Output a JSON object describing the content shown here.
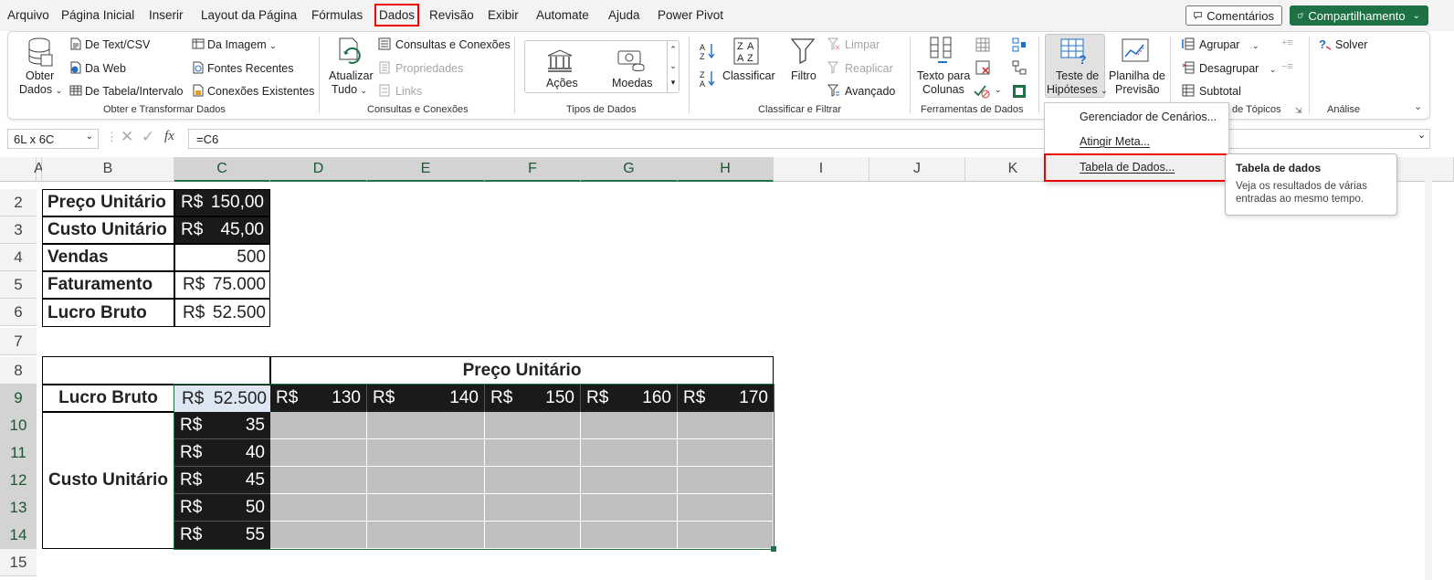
{
  "tabs": [
    "Arquivo",
    "Página Inicial",
    "Inserir",
    "Layout da Página",
    "Fórmulas",
    "Dados",
    "Revisão",
    "Exibir",
    "Automate",
    "Ajuda",
    "Power Pivot"
  ],
  "active_tab": "Dados",
  "header": {
    "comments": "Comentários",
    "share": "Compartilhamento"
  },
  "ribbon": {
    "get_data": {
      "label1": "Obter",
      "label2": "Dados"
    },
    "from_text_csv": "De Text/CSV",
    "from_web": "Da Web",
    "from_table": "De Tabela/Intervalo",
    "from_image": "Da Imagem",
    "recent_sources": "Fontes Recentes",
    "existing_connections": "Conexões Existentes",
    "group_get_transform": "Obter e Transformar Dados",
    "refresh_all": {
      "label1": "Atualizar",
      "label2": "Tudo"
    },
    "queries_connections": "Consultas e Conexões",
    "properties": "Propriedades",
    "links": "Links",
    "group_queries": "Consultas e Conexões",
    "stocks": "Ações",
    "currencies": "Moedas",
    "group_data_types": "Tipos de Dados",
    "sort": "Classificar",
    "filter": "Filtro",
    "clear": "Limpar",
    "reapply": "Reaplicar",
    "advanced": "Avançado",
    "group_sort_filter": "Classificar e Filtrar",
    "text_to_columns": {
      "label1": "Texto para",
      "label2": "Colunas"
    },
    "group_data_tools": "Ferramentas de Dados",
    "what_if": {
      "label1": "Teste de",
      "label2": "Hipóteses"
    },
    "forecast_sheet": {
      "label1": "Planilha de",
      "label2": "Previsão"
    },
    "group": "Agrupar",
    "ungroup": "Desagrupar",
    "subtotal": "Subtotal",
    "group_outline": "de Tópicos",
    "solver": "Solver",
    "group_analysis": "Análise"
  },
  "formula_bar": {
    "name_box": "6L x 6C",
    "formula": "=C6",
    "fx": "fx"
  },
  "columns": [
    "A",
    "B",
    "C",
    "D",
    "E",
    "F",
    "G",
    "H",
    "I",
    "J",
    "K"
  ],
  "rows": [
    "2",
    "3",
    "4",
    "5",
    "6",
    "7",
    "8",
    "9",
    "10",
    "11",
    "12",
    "13",
    "14",
    "15"
  ],
  "sheet": {
    "labels": [
      "Preço Unitário",
      "Custo Unitário",
      "Vendas",
      "Faturamento",
      "Lucro Bruto"
    ],
    "values": [
      {
        "cur": "R$",
        "num": "150,00"
      },
      {
        "cur": "R$",
        "num": "45,00"
      },
      {
        "cur": "",
        "num": "500"
      },
      {
        "cur": "R$",
        "num": "75.000"
      },
      {
        "cur": "R$",
        "num": "52.500"
      }
    ],
    "data_table": {
      "header": "Preço Unitário",
      "corner_label": "Lucro Bruto",
      "corner_value": {
        "cur": "R$",
        "num": "52.500"
      },
      "row_label": "Custo Unitário",
      "prices": [
        "130",
        "140",
        "150",
        "160",
        "170"
      ],
      "costs": [
        "35",
        "40",
        "45",
        "50",
        "55"
      ],
      "currency": "R$"
    }
  },
  "menu": {
    "items": [
      "Gerenciador de Cenários...",
      "Atingir Meta...",
      "Tabela de Dados..."
    ]
  },
  "tooltip": {
    "title": "Tabela de dados",
    "text1": "Veja os resultados de várias",
    "text2": "entradas ao mesmo tempo."
  },
  "colors": {
    "excel_green": "#1e7145",
    "highlight_red": "#e00000",
    "dark_cell": "#1a1a1a",
    "gray_cell": "#bfbfbf"
  }
}
